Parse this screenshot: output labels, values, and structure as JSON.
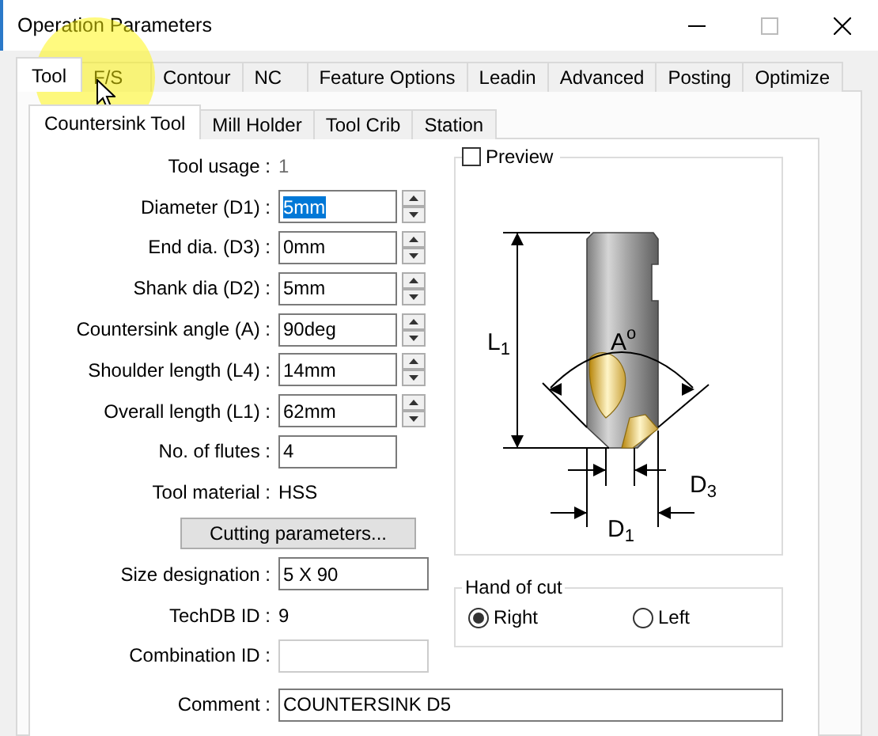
{
  "window": {
    "title": "Operation Parameters"
  },
  "tabs": [
    {
      "label": "Tool",
      "selected": true
    },
    {
      "label": "F/S",
      "selected": false
    },
    {
      "label": "Contour",
      "selected": false
    },
    {
      "label": "NC",
      "selected": false
    },
    {
      "label": "Feature Options",
      "selected": false
    },
    {
      "label": "Leadin",
      "selected": false
    },
    {
      "label": "Advanced",
      "selected": false
    },
    {
      "label": "Posting",
      "selected": false
    },
    {
      "label": "Optimize",
      "selected": false
    }
  ],
  "subtabs": [
    {
      "label": "Countersink Tool",
      "selected": true
    },
    {
      "label": "Mill Holder",
      "selected": false
    },
    {
      "label": "Tool Crib",
      "selected": false
    },
    {
      "label": "Station",
      "selected": false
    }
  ],
  "rows": [
    {
      "kind": "static",
      "label": "Tool usage :",
      "value": "1",
      "dim": true
    },
    {
      "kind": "spin",
      "label": "Diameter (D1) :",
      "value": "5mm",
      "text_selected": true
    },
    {
      "kind": "spin",
      "label": "End dia. (D3) :",
      "value": "0mm",
      "text_selected": false
    },
    {
      "kind": "spin",
      "label": "Shank dia (D2) :",
      "value": "5mm",
      "text_selected": false
    },
    {
      "kind": "spin",
      "label": "Countersink angle (A) :",
      "value": "90deg",
      "text_selected": false
    },
    {
      "kind": "spin",
      "label": "Shoulder length (L4) :",
      "value": "14mm",
      "text_selected": false
    },
    {
      "kind": "spin",
      "label": "Overall length (L1) :",
      "value": "62mm",
      "text_selected": false
    },
    {
      "kind": "input",
      "label": "No. of flutes :",
      "value": "4",
      "disabled": false
    },
    {
      "kind": "static",
      "label": "Tool material :",
      "value": "HSS",
      "dim": false
    },
    {
      "kind": "button",
      "label": "Cutting parameters..."
    },
    {
      "kind": "wide_input",
      "label": "Size designation :",
      "value": "5 X 90",
      "disabled": false
    },
    {
      "kind": "static",
      "label": "TechDB ID :",
      "value": "9",
      "dim": false
    },
    {
      "kind": "wide_input",
      "label": "Combination ID :",
      "disabled": true
    }
  ],
  "preview": {
    "label": "Preview",
    "checked": false,
    "dimension_labels": [
      {
        "base": "L",
        "sub": "1"
      },
      {
        "base": "A",
        "sup": "o"
      },
      {
        "base": "D",
        "sub": "3"
      },
      {
        "base": "D",
        "sub": "1"
      }
    ]
  },
  "hand_of_cut": {
    "title": "Hand of cut",
    "options": [
      {
        "label": "Right",
        "selected": true
      },
      {
        "label": "Left",
        "selected": false
      }
    ]
  },
  "comment": {
    "label": "Comment :",
    "value": "COUNTERSINK D5"
  }
}
